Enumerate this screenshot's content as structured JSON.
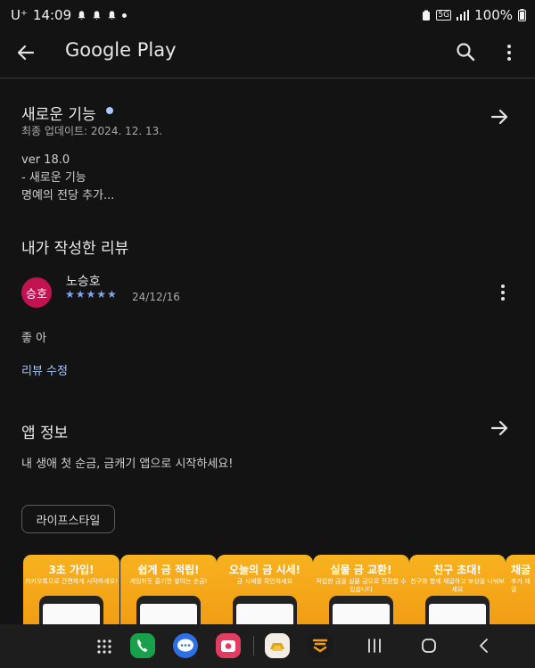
{
  "status_bar": {
    "carrier": "U⁺",
    "time": "14:09",
    "network": "5G",
    "battery": "100%"
  },
  "app_bar": {
    "title": "Google Play"
  },
  "whats_new": {
    "title": "새로운 기능",
    "updated": "최종 업데이트: 2024. 12. 13.",
    "lines": [
      "ver 18.0",
      "- 새로운 기능",
      "명예의 전당 추가..."
    ]
  },
  "my_review": {
    "heading": "내가 작성한 리뷰",
    "avatar_text": "승호",
    "author": "노승호",
    "stars": 5,
    "star_glyphs": "★★★★★",
    "date": "24/12/16",
    "text": "좋 아",
    "edit_link": "리뷰 수정"
  },
  "app_info": {
    "heading": "앱 정보",
    "description": "내 생애 첫 순금, 금캐기 앱으로 시작하세요!",
    "category_chip": "라이프스타일"
  },
  "screenshots": [
    {
      "title": "3초 가입!",
      "sub": "카카오톡으로 간편하게 시작하세요!"
    },
    {
      "title": "쉽게 금 적립!",
      "sub": "게임하듯 즐기면 쌓이는 순금!"
    },
    {
      "title": "오늘의 금 시세!",
      "sub": "금 시세를 확인하세요"
    },
    {
      "title": "실물 금 교환!",
      "sub": "적립한 금을 실물 금으로 전환할 수 있습니다"
    },
    {
      "title": "친구 초대!",
      "sub": "친구와 함께 채굴하고 보상을 나눠보세요"
    },
    {
      "title": "채굴",
      "sub": "추가 채굴"
    }
  ],
  "colors": {
    "background": "#131313",
    "accent_link": "#a8c7fa",
    "avatar": "#c0134f",
    "screenshot_bg": "#f7b21f"
  }
}
